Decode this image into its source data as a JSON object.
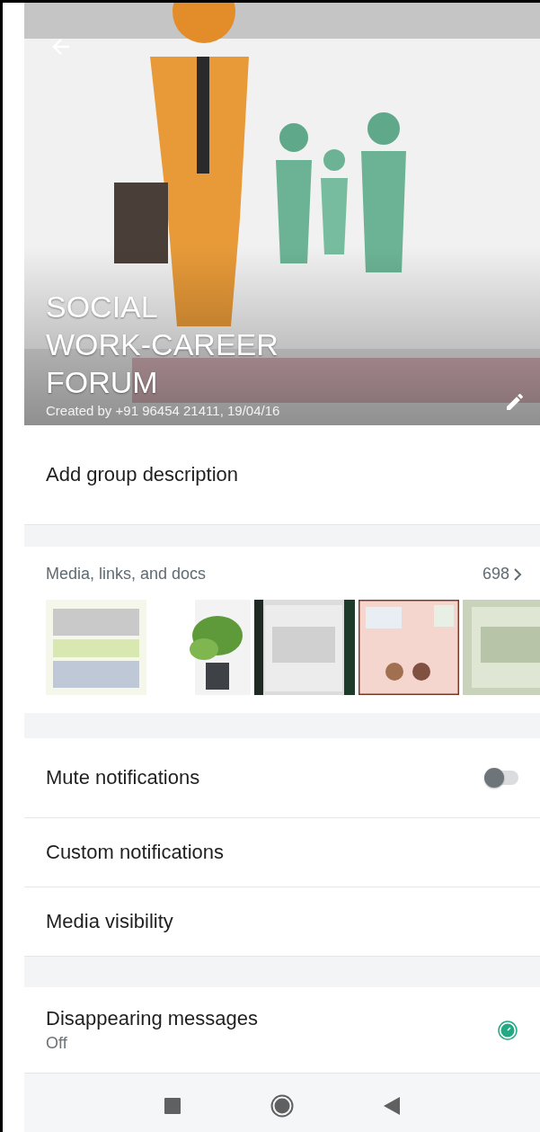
{
  "header": {
    "title": "SOCIAL\nWORK-CAREER\nFORUM",
    "subtitle": "Created by +91 96454 21411, 19/04/16"
  },
  "description": {
    "label": "Add group description"
  },
  "media": {
    "label": "Media, links, and docs",
    "count": "698"
  },
  "settings": [
    {
      "label": "Mute notifications",
      "kind": "toggle",
      "on": false
    },
    {
      "label": "Custom notifications",
      "kind": "plain"
    },
    {
      "label": "Media visibility",
      "kind": "plain"
    }
  ],
  "disappearing": {
    "label": "Disappearing messages",
    "value": "Off"
  }
}
